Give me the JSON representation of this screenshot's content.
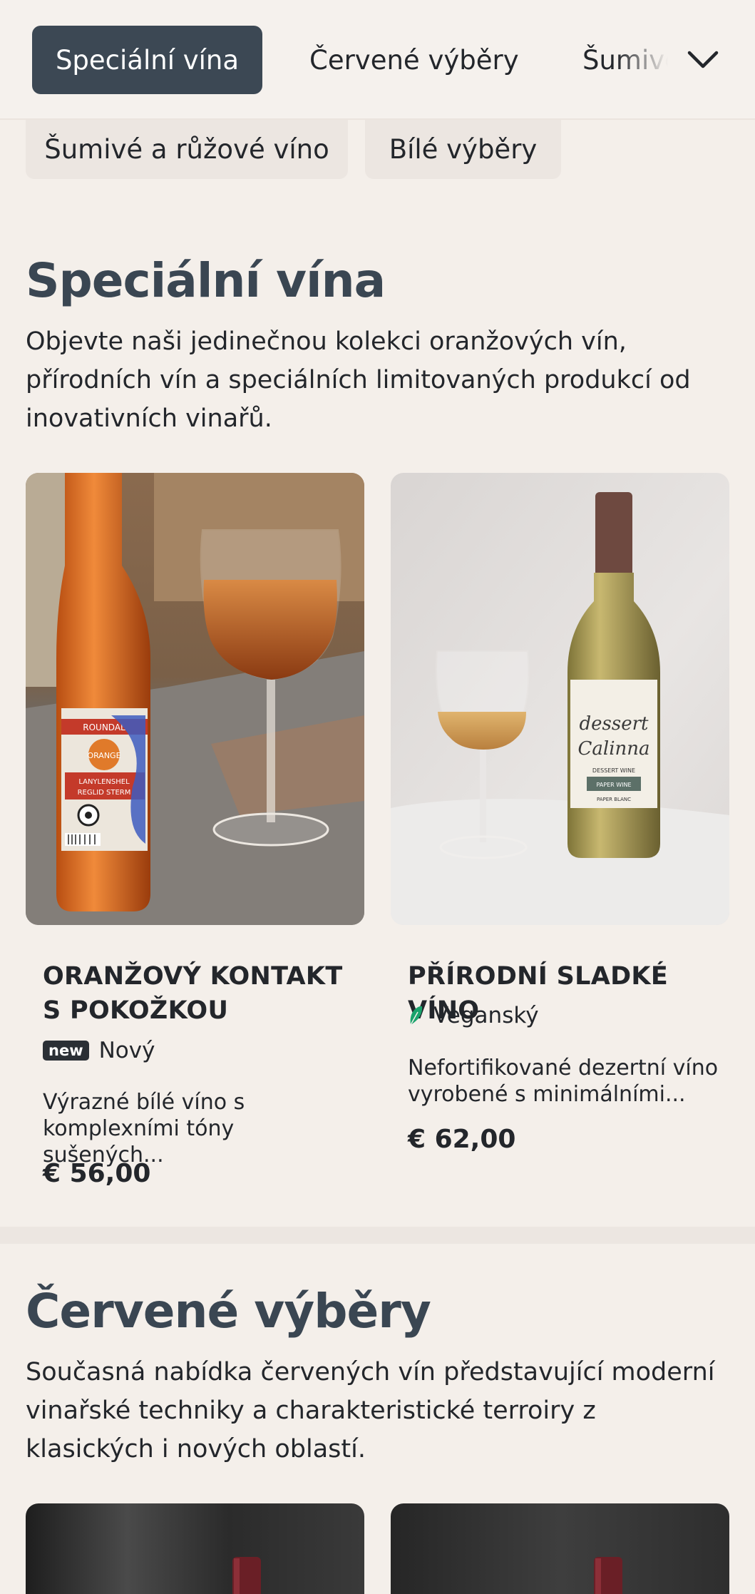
{
  "nav": {
    "tabs": [
      "Speciální vína",
      "Červené výběry",
      "Šumivé"
    ],
    "active": "Speciální vína",
    "more_icon": "chevron-down-icon",
    "row2": [
      "Šumivé a růžové víno",
      "Bílé výběry"
    ]
  },
  "special": {
    "title": "Speciální vína",
    "description": "Objevte naši jedinečnou kolekci oranžových vín, přírodních vín a speciálních limitovaných produkcí od inovativních vinařů.",
    "products": [
      {
        "name": "ORANŽOVÝ KONTAKT S POKOŽKOU",
        "badge_icon": "new",
        "badge_text": "Nový",
        "description": "Výrazné bílé víno s komplexními tóny sušených...",
        "price": "€ 56,00",
        "label_brand": "ROUNDAL",
        "label_line1": "ORANGE",
        "label_line2": "LANYLENSHEL",
        "label_line3": "REGLID STERM"
      },
      {
        "name": "PŘÍRODNÍ SLADKÉ VÍNO",
        "badge_icon": "leaf-icon",
        "badge_text": "Veganský",
        "description": "Nefortifikované dezertní víno vyrobené s minimálními...",
        "price": "€ 62,00",
        "label_script1": "dessert",
        "label_script2": "Calinna",
        "label_line1": "DESSERT WINE",
        "label_line2": "PAPER WINE",
        "label_line3": "PAPER BLANC"
      }
    ]
  },
  "red": {
    "title": "Červené výběry",
    "description": "Současná nabídka červených vín představující moderní vinařské techniky a charakteristické terroiry z klasických i nových oblastí."
  },
  "colors": {
    "accent": "#3c4854",
    "background": "#f4efea",
    "leaf": "#1aa36c"
  }
}
